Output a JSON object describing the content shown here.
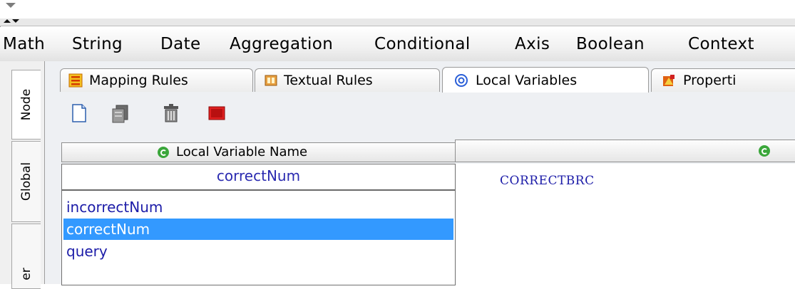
{
  "menubar": {
    "items": [
      "Math",
      "String",
      "Date",
      "Aggregation",
      "Conditional",
      "Axis",
      "Boolean",
      "Context"
    ]
  },
  "vertical_tabs": [
    {
      "label": "Node",
      "active": true
    },
    {
      "label": "Global",
      "active": false
    },
    {
      "label": "er",
      "active": false
    }
  ],
  "tabs": [
    {
      "label": "Mapping Rules",
      "icon": "mapping-rules-icon"
    },
    {
      "label": "Textual Rules",
      "icon": "textual-rules-icon"
    },
    {
      "label": "Local Variables",
      "icon": "at-sign-icon",
      "active": true
    },
    {
      "label": "Properti",
      "icon": "properties-icon"
    }
  ],
  "toolbar": {
    "buttons": [
      "new-document-icon",
      "copy-icon",
      "trash-icon",
      "stop-icon"
    ]
  },
  "table": {
    "column1_header": "Local Variable Name",
    "column2_header": "",
    "selected_value": "correctNum",
    "rows": [
      "incorrectNum",
      "correctNum",
      "query"
    ],
    "selected_row_index": 1,
    "value_text": "CORRECTBRC"
  },
  "colors": {
    "selection": "#3399ff",
    "row_text": "#1c1ca8"
  }
}
